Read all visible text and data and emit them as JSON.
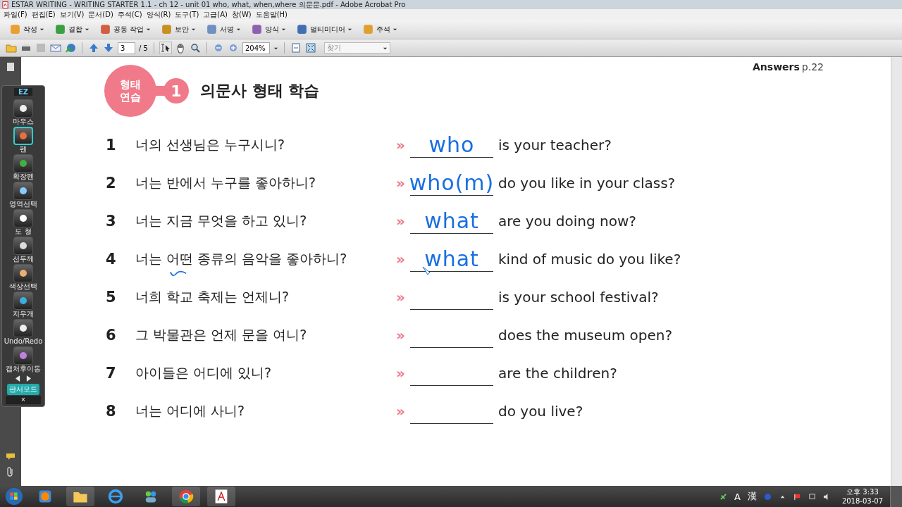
{
  "window": {
    "title": "ESTAR WRITING - WRITING STARTER 1.1 -  ch 12 - unit 01 who, what, when,where 의문문.pdf - Adobe Acrobat Pro"
  },
  "menu": [
    "파일(F)",
    "편집(E)",
    "보기(V)",
    "문서(D)",
    "주석(C)",
    "양식(R)",
    "도구(T)",
    "고급(A)",
    "창(W)",
    "도움말(H)"
  ],
  "toolbar": [
    "작성",
    "결합",
    "공동 작업",
    "보안",
    "서명",
    "양식",
    "멀티미디어",
    "주석"
  ],
  "nav": {
    "page": "3",
    "total": "/ 5",
    "zoom": "204%",
    "search_placeholder": "찾기"
  },
  "ez": {
    "logo": "EZ",
    "tools": [
      {
        "label": "마우스",
        "selected": false
      },
      {
        "label": "펜",
        "selected": true
      },
      {
        "label": "확장펜",
        "selected": false
      },
      {
        "label": "영역선택",
        "selected": false
      },
      {
        "label": "도 형",
        "selected": false
      },
      {
        "label": "선두께",
        "selected": false
      },
      {
        "label": "색상선택",
        "selected": false
      },
      {
        "label": "지우개",
        "selected": false
      },
      {
        "label": "Undo/Redo",
        "selected": false
      },
      {
        "label": "캡처후이동",
        "selected": false
      }
    ],
    "mode": "판서모드",
    "close": "×"
  },
  "page": {
    "answers_label": "Answers",
    "answers_page": "p.22",
    "badge": [
      "형태",
      "연습"
    ],
    "number": "1",
    "title": "의문사 형태 학습",
    "rows": [
      {
        "number": "1",
        "korean": "너의 선생님은 누구시니?",
        "marker": "»",
        "answer": "who",
        "english": "is your teacher?"
      },
      {
        "number": "2",
        "korean": "너는 반에서 누구를 좋아하니?",
        "marker": "»",
        "answer": "who(m)",
        "english": "do you like in your class?"
      },
      {
        "number": "3",
        "korean": "너는 지금 무엇을 하고 있니?",
        "marker": "»",
        "answer": "what",
        "english": "are you doing now?"
      },
      {
        "number": "4",
        "korean": "너는 어떤 종류의 음악을 좋아하니?",
        "marker": "»",
        "answer": "what",
        "english": "kind of music do you like?"
      },
      {
        "number": "5",
        "korean": "너희 학교 축제는 언제니?",
        "marker": "»",
        "english": "is your school festival?"
      },
      {
        "number": "6",
        "korean": "그 박물관은 언제 문을 여니?",
        "marker": "»",
        "english": "does the museum open?"
      },
      {
        "number": "7",
        "korean": "아이들은 어디에 있니?",
        "marker": "»",
        "english": "are the children?"
      },
      {
        "number": "8",
        "korean": "너는 어디에 사니?",
        "marker": "»",
        "english": "do you live?"
      }
    ]
  },
  "taskbar": {
    "tray": [
      "A",
      "漢"
    ],
    "time": "오후 3:33",
    "date": "2018-03-07"
  }
}
